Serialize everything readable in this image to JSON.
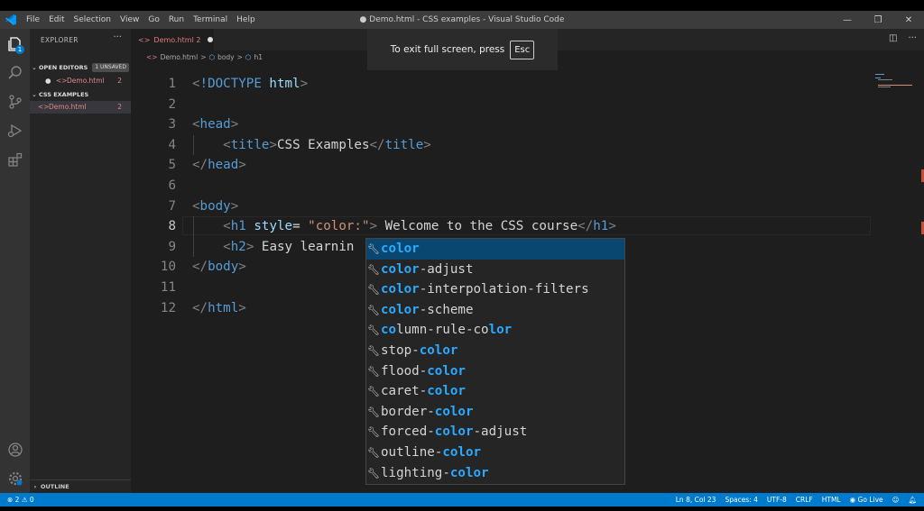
{
  "window": {
    "title": "● Demo.html - CSS examples - Visual Studio Code",
    "menu": [
      "File",
      "Edit",
      "Selection",
      "View",
      "Go",
      "Run",
      "Terminal",
      "Help"
    ]
  },
  "activity_bar": {
    "explorer_badge": "1",
    "icons": [
      "files-icon",
      "search-icon",
      "source-control-icon",
      "run-debug-icon",
      "extensions-icon",
      "account-icon",
      "manage-gear-icon"
    ]
  },
  "sidebar": {
    "title": "EXPLORER",
    "more": "···",
    "open_editors": {
      "label": "OPEN EDITORS",
      "badge": "1 UNSAVED"
    },
    "open_file": {
      "name": "Demo.html",
      "count": "2"
    },
    "folder": {
      "label": "CSS EXAMPLES"
    },
    "folder_file": {
      "name": "Demo.html",
      "count": "2"
    },
    "outline": "OUTLINE"
  },
  "tab": {
    "label": "Demo.html 2"
  },
  "breadcrumb": {
    "file": "Demo.html",
    "sep": ">",
    "item1": "body",
    "item2": "h1"
  },
  "toast": {
    "text": "To exit full screen, press",
    "key": "Esc"
  },
  "editor": {
    "lines": [
      {
        "n": "1",
        "parts": [
          [
            "pun",
            "<"
          ],
          [
            "tag",
            "!DOCTYPE "
          ],
          [
            "attr",
            "html"
          ],
          [
            "pun",
            ">"
          ]
        ]
      },
      {
        "n": "2",
        "parts": []
      },
      {
        "n": "3",
        "parts": [
          [
            "pun",
            "<"
          ],
          [
            "tag",
            "head"
          ],
          [
            "pun",
            ">"
          ]
        ]
      },
      {
        "n": "4",
        "parts": [
          [
            "txt",
            "    "
          ],
          [
            "pun",
            "<"
          ],
          [
            "tag",
            "title"
          ],
          [
            "pun",
            ">"
          ],
          [
            "txt",
            "CSS Examples"
          ],
          [
            "pun",
            "</"
          ],
          [
            "tag",
            "title"
          ],
          [
            "pun",
            ">"
          ]
        ]
      },
      {
        "n": "5",
        "parts": [
          [
            "pun",
            "</"
          ],
          [
            "tag",
            "head"
          ],
          [
            "pun",
            ">"
          ]
        ]
      },
      {
        "n": "6",
        "parts": []
      },
      {
        "n": "7",
        "parts": [
          [
            "pun",
            "<"
          ],
          [
            "tag",
            "body"
          ],
          [
            "pun",
            ">"
          ]
        ]
      },
      {
        "n": "8",
        "parts": [
          [
            "txt",
            "    "
          ],
          [
            "pun",
            "<"
          ],
          [
            "tag",
            "h1"
          ],
          [
            "txt",
            " "
          ],
          [
            "attr",
            "style"
          ],
          [
            "txt",
            "= "
          ],
          [
            "str",
            "\"color:\""
          ],
          [
            "pun",
            ">"
          ],
          [
            "txt",
            " Welcome to the CSS course"
          ],
          [
            "pun",
            "</"
          ],
          [
            "tag",
            "h1"
          ],
          [
            "pun",
            ">"
          ]
        ]
      },
      {
        "n": "9",
        "parts": [
          [
            "txt",
            "    "
          ],
          [
            "pun",
            "<"
          ],
          [
            "tag",
            "h2"
          ],
          [
            "pun",
            ">"
          ],
          [
            "txt",
            " Easy learnin"
          ]
        ]
      },
      {
        "n": "10",
        "parts": [
          [
            "pun",
            "</"
          ],
          [
            "tag",
            "body"
          ],
          [
            "pun",
            ">"
          ]
        ]
      },
      {
        "n": "11",
        "parts": []
      },
      {
        "n": "12",
        "parts": [
          [
            "pun",
            "</"
          ],
          [
            "tag",
            "html"
          ],
          [
            "pun",
            ">"
          ]
        ]
      }
    ],
    "current_line": "8"
  },
  "suggestions": [
    [
      [
        "hl",
        "color"
      ]
    ],
    [
      [
        "hl",
        "color"
      ],
      [
        "",
        "-adjust"
      ]
    ],
    [
      [
        "hl",
        "color"
      ],
      [
        "",
        "-interpolation-filters"
      ]
    ],
    [
      [
        "hl",
        "color"
      ],
      [
        "",
        "-scheme"
      ]
    ],
    [
      [
        "hl",
        "co"
      ],
      [
        "",
        "lumn-rule-co"
      ],
      [
        "hl",
        "lor"
      ]
    ],
    [
      [
        "",
        "stop-"
      ],
      [
        "hl",
        "color"
      ]
    ],
    [
      [
        "",
        "flood-"
      ],
      [
        "hl",
        "color"
      ]
    ],
    [
      [
        "",
        "caret-"
      ],
      [
        "hl",
        "color"
      ]
    ],
    [
      [
        "",
        "border-"
      ],
      [
        "hl",
        "color"
      ]
    ],
    [
      [
        "",
        "forced-"
      ],
      [
        "hl",
        "color"
      ],
      [
        "",
        "-adjust"
      ]
    ],
    [
      [
        "",
        "outline-"
      ],
      [
        "hl",
        "color"
      ]
    ],
    [
      [
        "",
        "lighting-"
      ],
      [
        "hl",
        "color"
      ]
    ]
  ],
  "status": {
    "errors": "⊗ 2 ⚠ 0",
    "position": "Ln 8, Col 23",
    "spaces": "Spaces: 4",
    "encoding": "UTF-8",
    "eol": "CRLF",
    "language": "HTML",
    "golive": "◉ Go Live"
  },
  "colors": {
    "status_bar": "#007acc",
    "selection": "#094771",
    "match": "#2aaaff"
  }
}
